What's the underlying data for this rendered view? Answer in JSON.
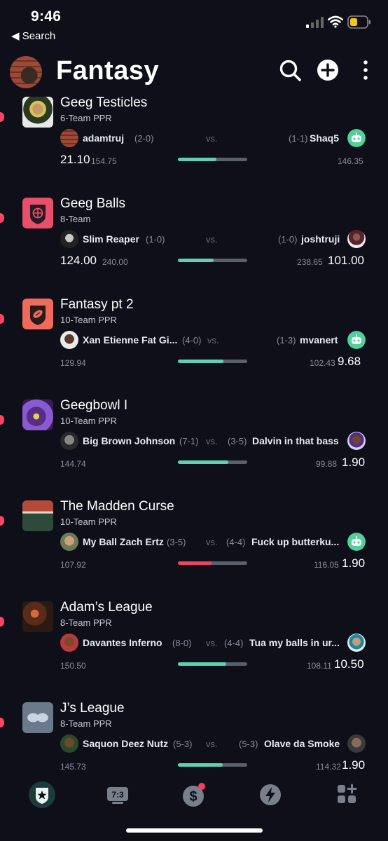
{
  "status_bar": {
    "time": "9:46",
    "back_label": "◀ Search"
  },
  "header": {
    "title": "Fantasy"
  },
  "leagues": [
    {
      "name": "Geeg Testicles",
      "type": "6-Team PPR",
      "home": {
        "team": "adamtruj",
        "record": "(2-0)",
        "score": "21.10",
        "projected": "154.75"
      },
      "away": {
        "team": "Shaq5",
        "record": "(1-1)",
        "score": "",
        "projected": "146.35"
      },
      "vs": "vs.",
      "progress": 0.56,
      "bar_color": "#5ed1b0"
    },
    {
      "name": "Geeg Balls",
      "type": "8-Team",
      "home": {
        "team": "Slim Reaper",
        "record": "(1-0)",
        "score": "124.00",
        "projected": "240.00"
      },
      "away": {
        "team": "joshtruji",
        "record": "(1-0)",
        "score": "101.00",
        "projected": "238.65"
      },
      "vs": "vs.",
      "progress": 0.52,
      "bar_color": "#5ed1b0"
    },
    {
      "name": "Fantasy pt 2",
      "type": "10-Team PPR",
      "home": {
        "team": "Xan Etienne Fat Gi...",
        "record": "(4-0)",
        "score": "",
        "projected": "129.94"
      },
      "away": {
        "team": "mvanert",
        "record": "(1-3)",
        "score": "9.68",
        "projected": "102.43"
      },
      "vs": "vs.",
      "progress": 0.66,
      "bar_color": "#5ed1b0"
    },
    {
      "name": "Geegbowl I",
      "type": "10-Team PPR",
      "home": {
        "team": "Big Brown Johnson",
        "record": "(7-1)",
        "score": "",
        "projected": "144.74"
      },
      "away": {
        "team": "Dalvin in that bass",
        "record": "(3-5)",
        "score": "1.90",
        "projected": "99.88"
      },
      "vs": "vs.",
      "progress": 0.73,
      "bar_color": "#5ed1b0"
    },
    {
      "name": "The Madden Curse",
      "type": "10-Team PPR",
      "home": {
        "team": "My Ball Zach Ertz",
        "record": "(3-5)",
        "score": "",
        "projected": "107.92"
      },
      "away": {
        "team": "Fuck up butterku...",
        "record": "(4-4)",
        "score": "1.90",
        "projected": "116.05"
      },
      "vs": "vs.",
      "progress": 0.48,
      "bar_color": "#e8475f"
    },
    {
      "name": "Adam’s League",
      "type": "8-Team PPR",
      "home": {
        "team": "Davantes Inferno",
        "record": "(8-0)",
        "score": "",
        "projected": "150.50"
      },
      "away": {
        "team": "Tua my balls in ur...",
        "record": "(4-4)",
        "score": "10.50",
        "projected": "108.11"
      },
      "vs": "vs.",
      "progress": 0.7,
      "bar_color": "#5ed1b0"
    },
    {
      "name": "J’s League",
      "type": "8-Team PPR",
      "home": {
        "team": "Saquon Deez Nutz",
        "record": "(5-3)",
        "score": "",
        "projected": "145.73"
      },
      "away": {
        "team": "Olave da Smoke",
        "record": "(5-3)",
        "score": "1.90",
        "projected": "114.32"
      },
      "vs": "vs.",
      "progress": 0.65,
      "bar_color": "#5ed1b0"
    }
  ],
  "bottom_nav": [
    {
      "icon": "shield-star-icon",
      "active": true
    },
    {
      "icon": "scoreboard-icon",
      "label": "7:3"
    },
    {
      "icon": "dollar-icon",
      "badge": true
    },
    {
      "icon": "lightning-icon"
    },
    {
      "icon": "grid-plus-icon"
    }
  ],
  "colors": {
    "background": "#0f0f1a",
    "accent_green": "#5ed1b0",
    "accent_red": "#e8475f",
    "marker": "#ff4466"
  }
}
